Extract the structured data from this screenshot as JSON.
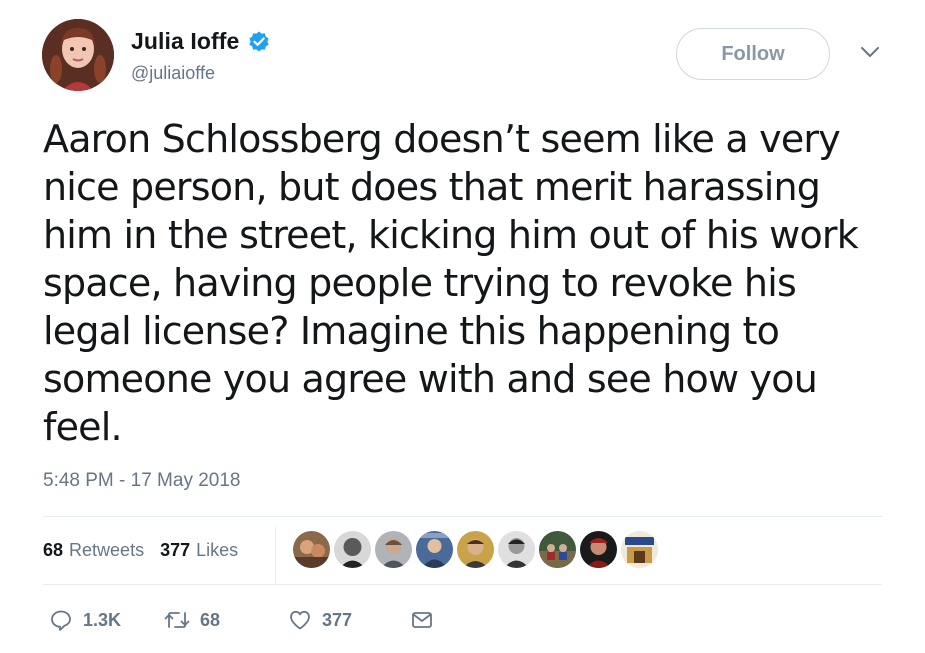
{
  "author": {
    "display_name": "Julia Ioffe",
    "handle": "@juliaioffe",
    "verified_icon": "verified-badge-icon"
  },
  "header": {
    "follow_label": "Follow",
    "more_icon": "chevron-down-icon"
  },
  "tweet": {
    "text": "Aaron Schlossberg doesn’t seem like a very\nnice person, but does that merit harassing\nhim in the street, kicking him out of his work\nspace, having people trying to revoke his\nlegal license? Imagine this happening to\nsomeone you agree with and see how you\nfeel.",
    "timestamp": "5:48 PM - 17 May 2018"
  },
  "stats": {
    "retweets_count": "68",
    "retweets_label": "Retweets",
    "likes_count": "377",
    "likes_label": "Likes"
  },
  "liker_avatars": [
    {
      "name": "liker-avatar-1"
    },
    {
      "name": "liker-avatar-2"
    },
    {
      "name": "liker-avatar-3"
    },
    {
      "name": "liker-avatar-4"
    },
    {
      "name": "liker-avatar-5"
    },
    {
      "name": "liker-avatar-6"
    },
    {
      "name": "liker-avatar-7"
    },
    {
      "name": "liker-avatar-8"
    },
    {
      "name": "liker-avatar-9"
    }
  ],
  "actions": {
    "reply_count": "1.3K",
    "retweet_count": "68",
    "like_count": "377"
  },
  "colors": {
    "verified_blue": "#1da1f2",
    "secondary_text": "#657786",
    "primary_text": "#14171a",
    "divider": "#e6ecf0"
  }
}
